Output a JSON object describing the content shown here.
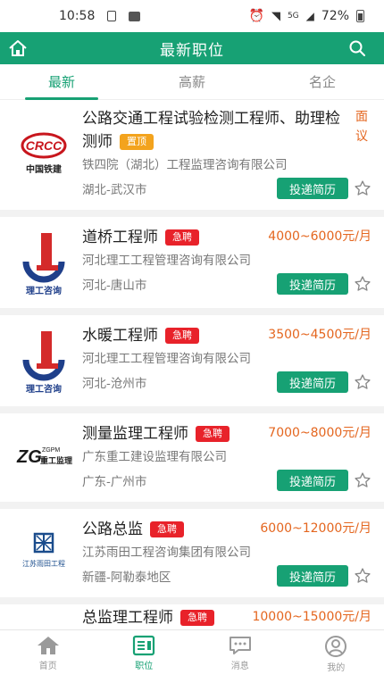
{
  "status_bar": {
    "time": "10:58",
    "network": "5G",
    "battery": "72%"
  },
  "header": {
    "title": "最新职位"
  },
  "tabs": [
    {
      "label": "最新"
    },
    {
      "label": "高薪"
    },
    {
      "label": "名企"
    }
  ],
  "apply_label": "投递简历",
  "jobs": [
    {
      "title": "公路交通工程试验检测工程师、助理检测师",
      "badge": "置顶",
      "salary": "面议",
      "company": "铁四院（湖北）工程监理咨询有限公司",
      "location": "湖北-武汉市",
      "logo_text": "中国铁建",
      "logo_mark": "CRCC"
    },
    {
      "title": "道桥工程师",
      "badge": "急聘",
      "salary": "4000~6000元/月",
      "company": "河北理工工程管理咨询有限公司",
      "location": "河北-唐山市",
      "logo_text": "理工咨询"
    },
    {
      "title": "水暖工程师",
      "badge": "急聘",
      "salary": "3500~4500元/月",
      "company": "河北理工工程管理咨询有限公司",
      "location": "河北-沧州市",
      "logo_text": "理工咨询"
    },
    {
      "title": "测量监理工程师",
      "badge": "急聘",
      "salary": "7000~8000元/月",
      "company": "广东重工建设监理有限公司",
      "location": "广东-广州市",
      "logo_text": "重工监理",
      "logo_mark": "ZGPM"
    },
    {
      "title": "公路总监",
      "badge": "急聘",
      "salary": "6000~12000元/月",
      "company": "江苏雨田工程咨询集团有限公司",
      "location": "新疆-阿勒泰地区",
      "logo_text": "江苏雨田工程"
    },
    {
      "title": "总监理工程师",
      "badge": "急聘",
      "salary": "10000~15000元/月"
    }
  ],
  "bottom_nav": [
    {
      "label": "首页",
      "icon": "home-icon"
    },
    {
      "label": "职位",
      "icon": "job-list-icon"
    },
    {
      "label": "消息",
      "icon": "message-icon"
    },
    {
      "label": "我的",
      "icon": "profile-icon"
    }
  ],
  "colors": {
    "primary": "#17a174",
    "salary": "#e4661f",
    "urgent": "#e8222a",
    "top": "#f3a31d"
  }
}
